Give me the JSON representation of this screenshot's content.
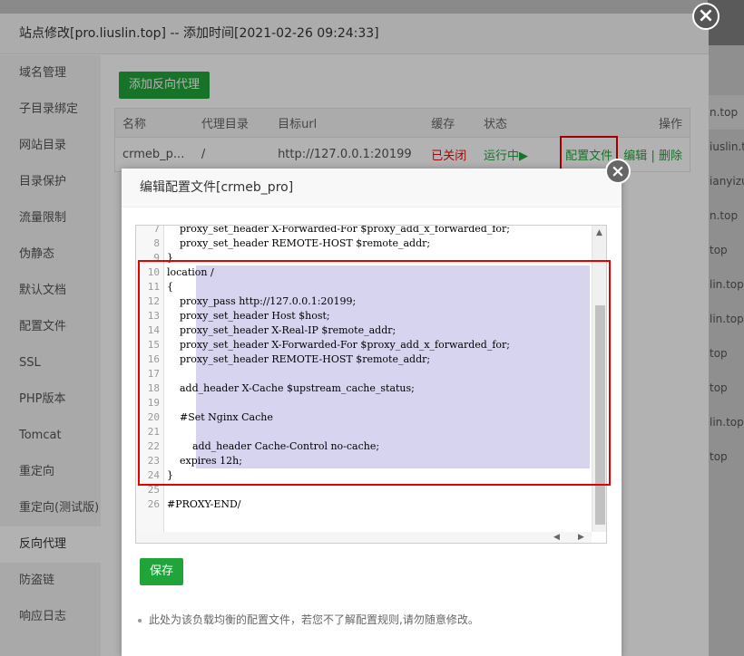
{
  "outer_modal": {
    "title": "站点修改[pro.liuslin.top] -- 添加时间[2021-02-26 09:24:33]",
    "close": "×"
  },
  "sidebar": {
    "items": [
      {
        "label": "域名管理"
      },
      {
        "label": "子目录绑定"
      },
      {
        "label": "网站目录"
      },
      {
        "label": "目录保护"
      },
      {
        "label": "流量限制"
      },
      {
        "label": "伪静态"
      },
      {
        "label": "默认文档"
      },
      {
        "label": "配置文件"
      },
      {
        "label": "SSL"
      },
      {
        "label": "PHP版本"
      },
      {
        "label": "Tomcat"
      },
      {
        "label": "重定向"
      },
      {
        "label": "重定向(测试版)"
      },
      {
        "label": "反向代理",
        "active": true
      },
      {
        "label": "防盗链"
      },
      {
        "label": "响应日志"
      }
    ]
  },
  "toolbar": {
    "add_proxy_label": "添加反向代理"
  },
  "proxy_table": {
    "headers": [
      "名称",
      "代理目录",
      "目标url",
      "缓存",
      "状态",
      "操作"
    ],
    "rows": [
      {
        "name": "crmeb_p...",
        "dir": "/",
        "target": "http://127.0.0.1:20199",
        "cache": "已关闭",
        "status": "运行中▶",
        "op_config": "配置文件",
        "op_edit": "编辑",
        "op_sep": "|",
        "op_delete": "删除"
      }
    ]
  },
  "background_rows": [
    "n.top",
    "iuslin.top",
    "ianyizu",
    "n.top",
    "top",
    "lin.top",
    "lin.top",
    "top",
    "top",
    "lin.top",
    "top"
  ],
  "inner_modal": {
    "title": "编辑配置文件[crmeb_pro]",
    "close": "×",
    "save_label": "保存",
    "note": "此处为该负载均衡的配置文件，若您不了解配置规则,请勿随意修改。"
  },
  "code_lines": [
    {
      "n": "7",
      "text": "    proxy_set_header X-Forwarded-For $proxy_add_x_forwarded_for;"
    },
    {
      "n": "8",
      "text": "    proxy_set_header REMOTE-HOST $remote_addr;"
    },
    {
      "n": "9",
      "text": "}"
    },
    {
      "n": "10",
      "text": "location /"
    },
    {
      "n": "11",
      "text": "{"
    },
    {
      "n": "12",
      "text": "    proxy_pass http://127.0.0.1:20199;"
    },
    {
      "n": "13",
      "text": "    proxy_set_header Host $host;"
    },
    {
      "n": "14",
      "text": "    proxy_set_header X-Real-IP $remote_addr;"
    },
    {
      "n": "15",
      "text": "    proxy_set_header X-Forwarded-For $proxy_add_x_forwarded_for;"
    },
    {
      "n": "16",
      "text": "    proxy_set_header REMOTE-HOST $remote_addr;"
    },
    {
      "n": "17",
      "text": ""
    },
    {
      "n": "18",
      "text": "    add_header X-Cache $upstream_cache_status;"
    },
    {
      "n": "19",
      "text": ""
    },
    {
      "n": "20",
      "text": "    #Set Nginx Cache"
    },
    {
      "n": "21",
      "text": ""
    },
    {
      "n": "22",
      "text": "        add_header Cache-Control no-cache;"
    },
    {
      "n": "23",
      "text": "    expires 12h;"
    },
    {
      "n": "24",
      "text": "}"
    },
    {
      "n": "25",
      "text": ""
    },
    {
      "n": "26",
      "text": "#PROXY-END/"
    }
  ],
  "colors": {
    "accent_green": "#20a53a",
    "highlight_red": "#e60000",
    "selection": "#d7d4f0",
    "status_closed": "#ef0808"
  }
}
